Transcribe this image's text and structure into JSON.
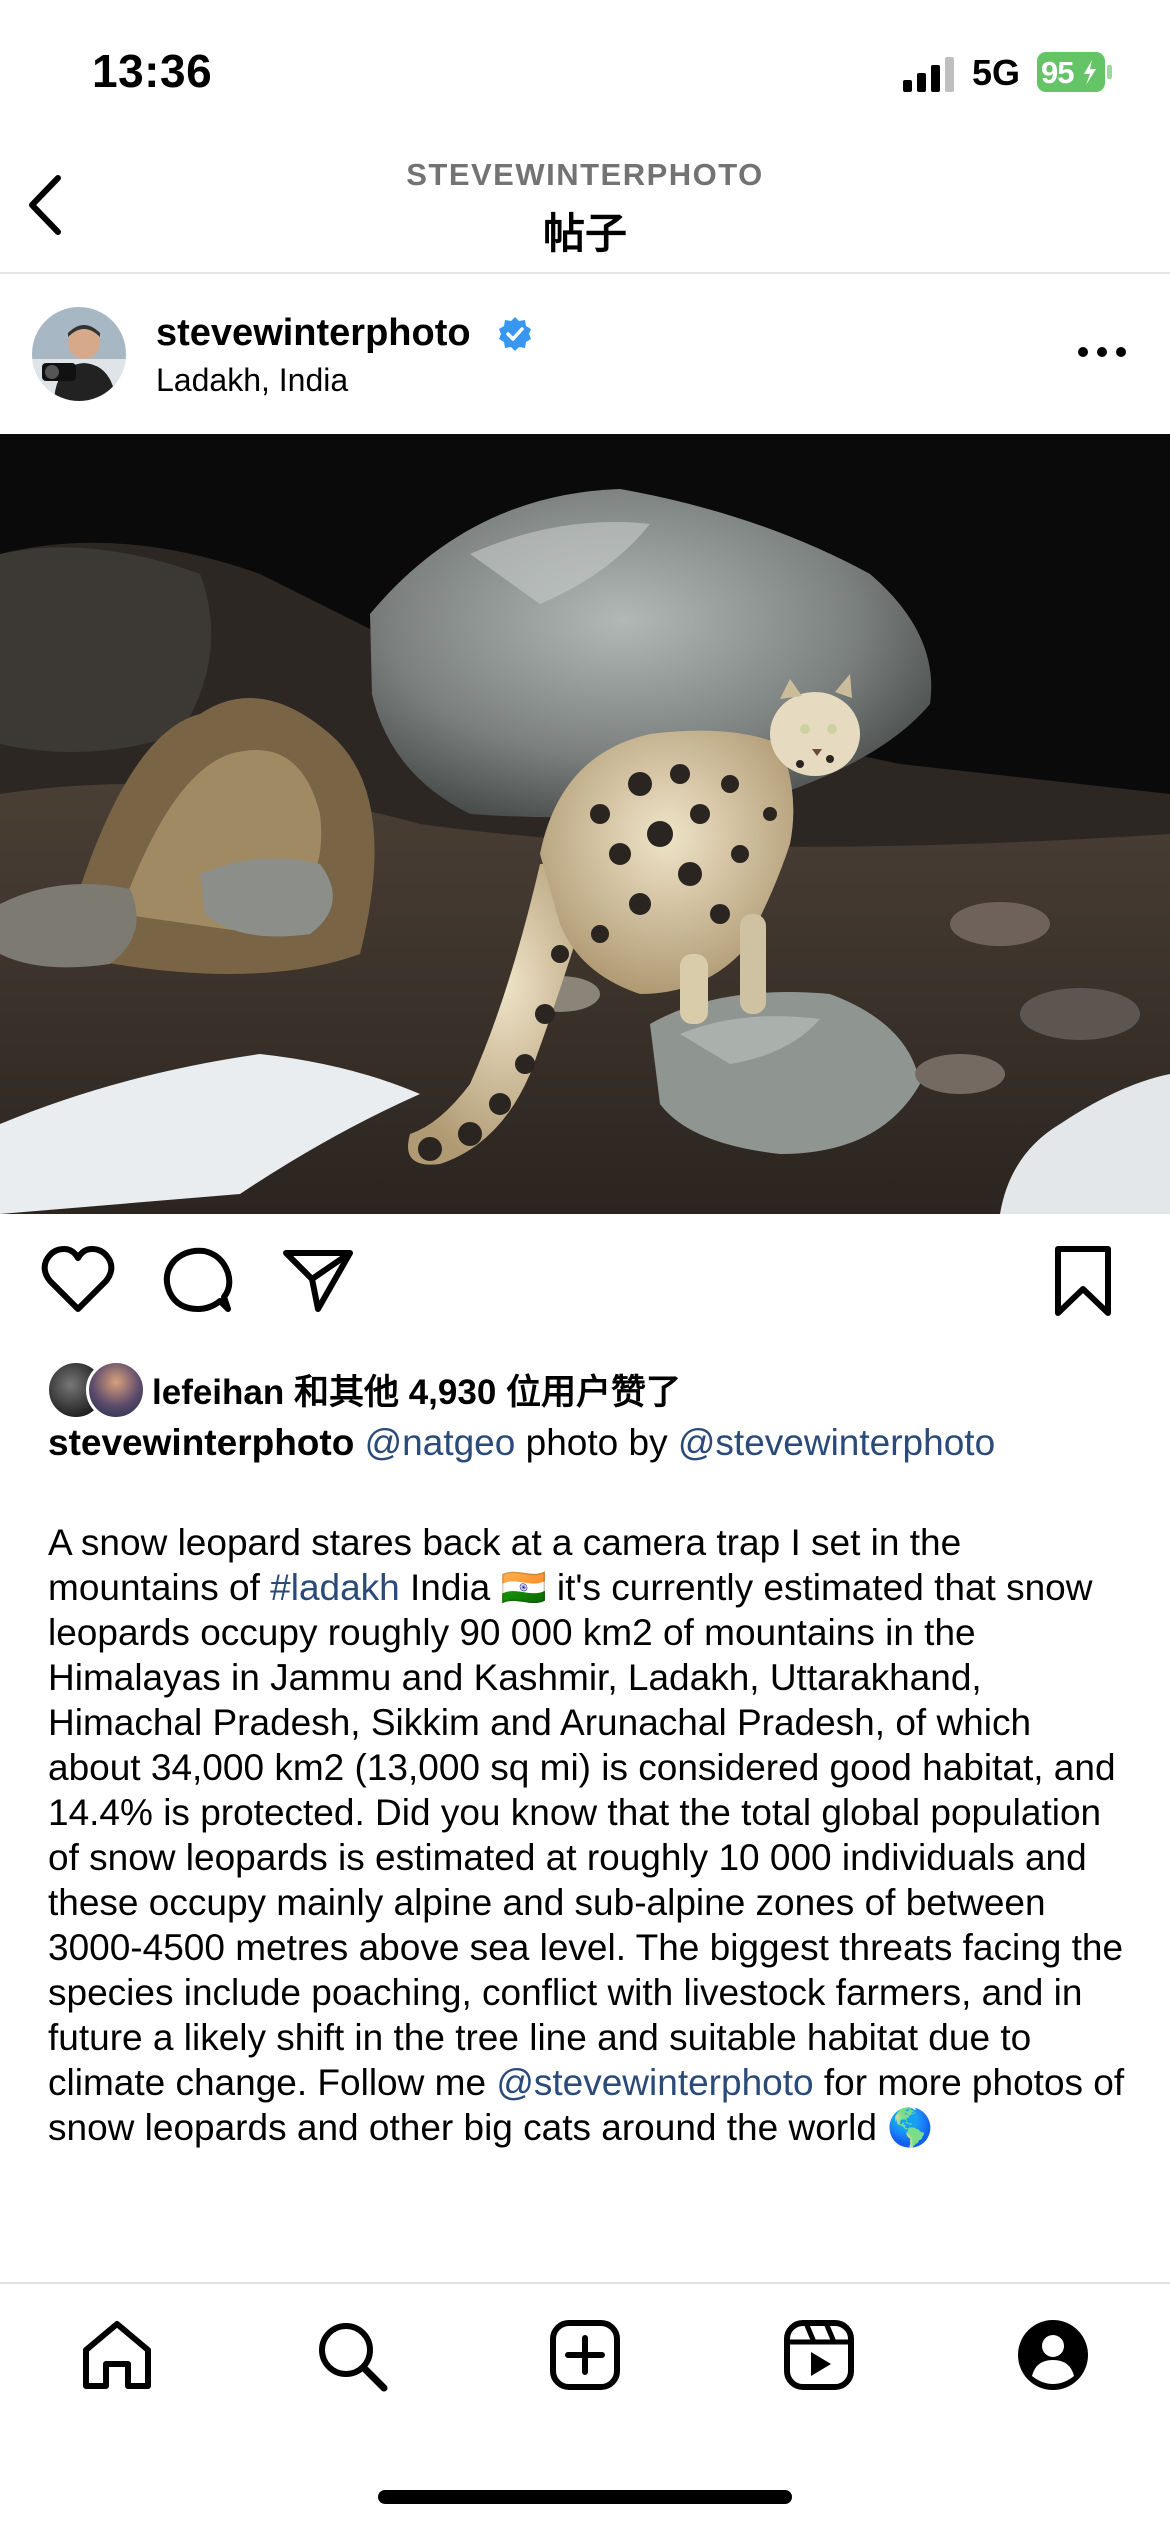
{
  "status_bar": {
    "time": "13:36",
    "network": "5G",
    "battery": "95"
  },
  "header": {
    "username": "STEVEWINTERPHOTO",
    "title": "帖子"
  },
  "post": {
    "username": "stevewinterphoto",
    "location": "Ladakh, India",
    "likes_text": "lefeihan 和其他 4,930 位用户赞了",
    "caption_user": "stevewinterphoto",
    "caption_mention1": "@natgeo",
    "caption_mid": " photo by ",
    "caption_mention2": "@stevewinterphoto",
    "body_1": "A snow leopard stares back at a camera trap I set in the mountains of ",
    "hashtag": "#ladakh",
    "body_2": " India 🇮🇳 it's currently estimated that snow leopards occupy roughly 90 000 km2 of mountains in the Himalayas in Jammu and Kashmir, Ladakh, Uttarakhand, Himachal Pradesh, Sikkim and Arunachal Pradesh, of which about 34,000 km2 (13,000 sq mi) is considered good habitat, and 14.4% is protected. Did you know that the total global population of snow leopards is estimated at roughly 10 000 individuals and these occupy mainly alpine and sub-alpine zones of between 3000-4500 metres above sea level. The biggest threats facing the species include poaching, conflict with livestock farmers, and in future a likely shift in the tree line and suitable habitat due to climate change. Follow me ",
    "mention3": "@stevewinterphoto",
    "body_3": " for more photos of snow leopards and other big cats around the world 🌎"
  },
  "icons": {
    "back": "chevron-left-icon",
    "verified": "verified-badge-icon",
    "more": "more-icon",
    "like": "heart-icon",
    "comment": "comment-icon",
    "share": "send-icon",
    "save": "bookmark-icon",
    "nav": [
      "home-icon",
      "search-icon",
      "create-icon",
      "reels-icon",
      "profile-icon"
    ]
  },
  "colors": {
    "link": "#2a4a7a",
    "verified": "#3897f0",
    "battery": "#65c466"
  }
}
